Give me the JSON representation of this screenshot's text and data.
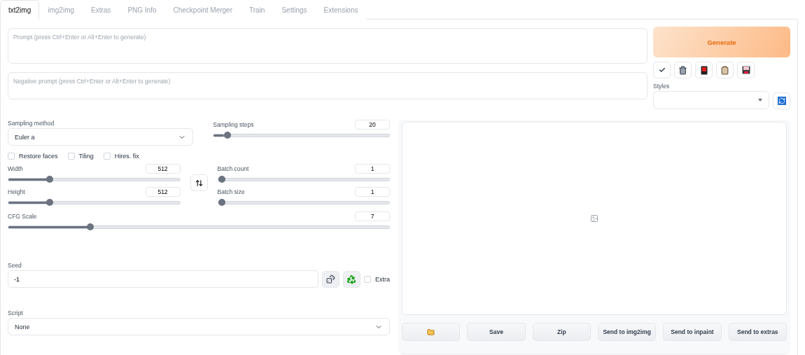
{
  "tabs": [
    {
      "label": "txt2img",
      "selected": true
    },
    {
      "label": "img2img",
      "selected": false
    },
    {
      "label": "Extras",
      "selected": false
    },
    {
      "label": "PNG Info",
      "selected": false
    },
    {
      "label": "Checkpoint Merger",
      "selected": false
    },
    {
      "label": "Train",
      "selected": false
    },
    {
      "label": "Settings",
      "selected": false
    },
    {
      "label": "Extensions",
      "selected": false
    }
  ],
  "prompt": {
    "placeholder": "Prompt (press Ctrl+Enter or Alt+Enter to generate)"
  },
  "negative_prompt": {
    "placeholder": "Negative prompt (press Ctrl+Enter or Alt+Enter to generate)"
  },
  "generate_button": "Generate",
  "styles": {
    "label": "Styles"
  },
  "sampling_method": {
    "label": "Sampling method",
    "value": "Euler a"
  },
  "sampling_steps": {
    "label": "Sampling steps",
    "value": "20",
    "level": 0.06
  },
  "checkboxes": [
    {
      "label": "Restore faces",
      "checked": false
    },
    {
      "label": "Tiling",
      "checked": false
    },
    {
      "label": "Hires. fix",
      "checked": false
    }
  ],
  "width": {
    "label": "Width",
    "value": "512",
    "level": 0.23
  },
  "height": {
    "label": "Height",
    "value": "512",
    "level": 0.23
  },
  "batch_count": {
    "label": "Batch count",
    "value": "1",
    "level": 0
  },
  "batch_size": {
    "label": "Batch size",
    "value": "1",
    "level": 0
  },
  "cfg_scale": {
    "label": "CFG Scale",
    "value": "7",
    "level": 0.21
  },
  "seed": {
    "label": "Seed",
    "value": "-1"
  },
  "extra": {
    "label": "Extra",
    "checked": false
  },
  "script": {
    "label": "Script",
    "value": "None"
  },
  "gallery_buttons": [
    "Save",
    "Zip",
    "Send to img2img",
    "Send to inpaint",
    "Send to extras"
  ]
}
